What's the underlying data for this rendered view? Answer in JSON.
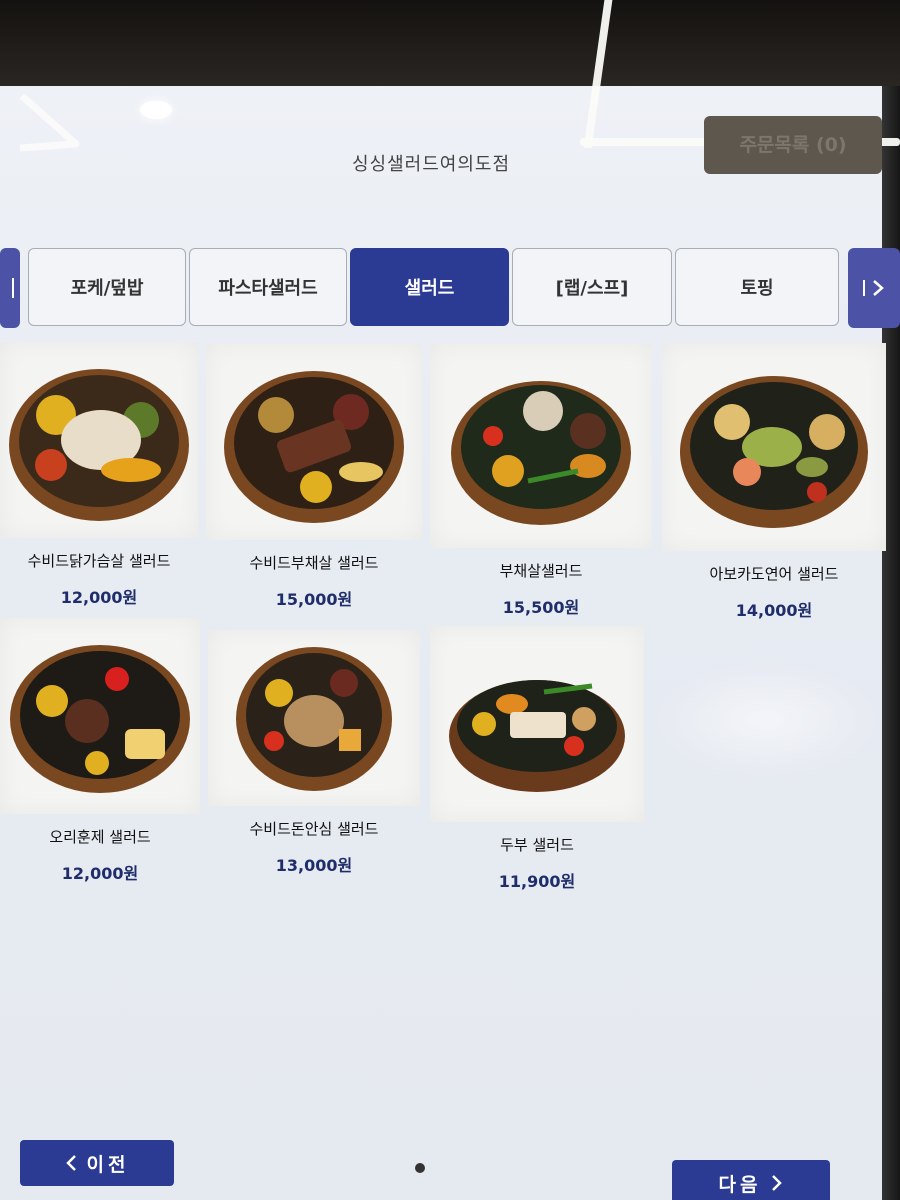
{
  "store_name": "싱싱샐러드여의도점",
  "order_button": {
    "label": "주문목록 (0)"
  },
  "tabs": [
    {
      "label": "포케/덮밥"
    },
    {
      "label": "파스타샐러드"
    },
    {
      "label": "샐러드",
      "active": true
    },
    {
      "label": "[랩/스프]"
    },
    {
      "label": "토핑"
    }
  ],
  "nav": {
    "prev_tab_icon": "bar-icon",
    "next_tab_icon": "chevron-right-icon"
  },
  "menu_items": [
    {
      "name": "수비드닭가슴살 샐러드",
      "price": "12,000원"
    },
    {
      "name": "수비드부채살 샐러드",
      "price": "15,000원"
    },
    {
      "name": "부채살샐러드",
      "price": "15,500원"
    },
    {
      "name": "아보카도연어 샐러드",
      "price": "14,000원"
    },
    {
      "name": "오리훈제 샐러드",
      "price": "12,000원"
    },
    {
      "name": "수비드돈안심 샐러드",
      "price": "13,000원"
    },
    {
      "name": "두부 샐러드",
      "price": "11,900원"
    }
  ],
  "footer": {
    "prev_label": "이전",
    "next_label": "다음"
  },
  "colors": {
    "accent": "#2b3a92",
    "price": "#1f2d6b"
  }
}
